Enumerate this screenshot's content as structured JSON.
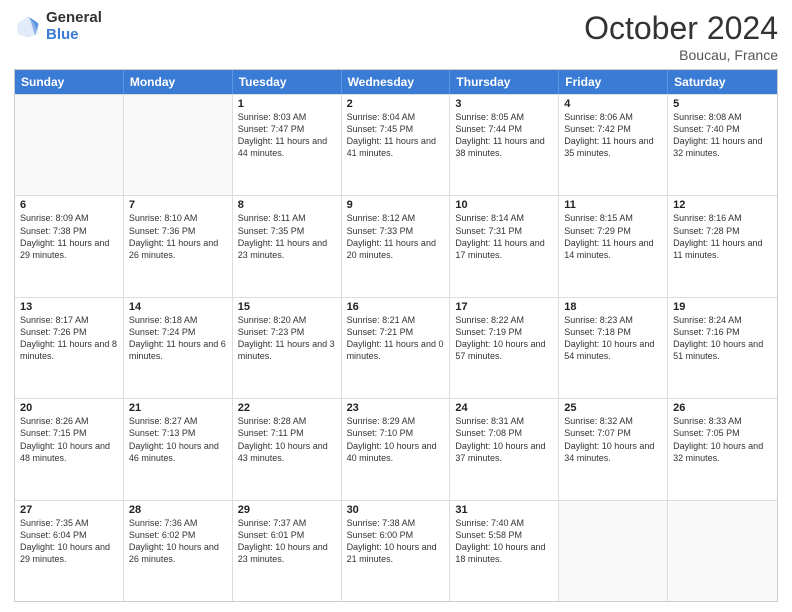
{
  "logo": {
    "general": "General",
    "blue": "Blue"
  },
  "header": {
    "month": "October 2024",
    "location": "Boucau, France"
  },
  "weekdays": [
    "Sunday",
    "Monday",
    "Tuesday",
    "Wednesday",
    "Thursday",
    "Friday",
    "Saturday"
  ],
  "rows": [
    [
      {
        "day": "",
        "info": "",
        "empty": true
      },
      {
        "day": "",
        "info": "",
        "empty": true
      },
      {
        "day": "1",
        "info": "Sunrise: 8:03 AM\nSunset: 7:47 PM\nDaylight: 11 hours and 44 minutes."
      },
      {
        "day": "2",
        "info": "Sunrise: 8:04 AM\nSunset: 7:45 PM\nDaylight: 11 hours and 41 minutes."
      },
      {
        "day": "3",
        "info": "Sunrise: 8:05 AM\nSunset: 7:44 PM\nDaylight: 11 hours and 38 minutes."
      },
      {
        "day": "4",
        "info": "Sunrise: 8:06 AM\nSunset: 7:42 PM\nDaylight: 11 hours and 35 minutes."
      },
      {
        "day": "5",
        "info": "Sunrise: 8:08 AM\nSunset: 7:40 PM\nDaylight: 11 hours and 32 minutes."
      }
    ],
    [
      {
        "day": "6",
        "info": "Sunrise: 8:09 AM\nSunset: 7:38 PM\nDaylight: 11 hours and 29 minutes."
      },
      {
        "day": "7",
        "info": "Sunrise: 8:10 AM\nSunset: 7:36 PM\nDaylight: 11 hours and 26 minutes."
      },
      {
        "day": "8",
        "info": "Sunrise: 8:11 AM\nSunset: 7:35 PM\nDaylight: 11 hours and 23 minutes."
      },
      {
        "day": "9",
        "info": "Sunrise: 8:12 AM\nSunset: 7:33 PM\nDaylight: 11 hours and 20 minutes."
      },
      {
        "day": "10",
        "info": "Sunrise: 8:14 AM\nSunset: 7:31 PM\nDaylight: 11 hours and 17 minutes."
      },
      {
        "day": "11",
        "info": "Sunrise: 8:15 AM\nSunset: 7:29 PM\nDaylight: 11 hours and 14 minutes."
      },
      {
        "day": "12",
        "info": "Sunrise: 8:16 AM\nSunset: 7:28 PM\nDaylight: 11 hours and 11 minutes."
      }
    ],
    [
      {
        "day": "13",
        "info": "Sunrise: 8:17 AM\nSunset: 7:26 PM\nDaylight: 11 hours and 8 minutes."
      },
      {
        "day": "14",
        "info": "Sunrise: 8:18 AM\nSunset: 7:24 PM\nDaylight: 11 hours and 6 minutes."
      },
      {
        "day": "15",
        "info": "Sunrise: 8:20 AM\nSunset: 7:23 PM\nDaylight: 11 hours and 3 minutes."
      },
      {
        "day": "16",
        "info": "Sunrise: 8:21 AM\nSunset: 7:21 PM\nDaylight: 11 hours and 0 minutes."
      },
      {
        "day": "17",
        "info": "Sunrise: 8:22 AM\nSunset: 7:19 PM\nDaylight: 10 hours and 57 minutes."
      },
      {
        "day": "18",
        "info": "Sunrise: 8:23 AM\nSunset: 7:18 PM\nDaylight: 10 hours and 54 minutes."
      },
      {
        "day": "19",
        "info": "Sunrise: 8:24 AM\nSunset: 7:16 PM\nDaylight: 10 hours and 51 minutes."
      }
    ],
    [
      {
        "day": "20",
        "info": "Sunrise: 8:26 AM\nSunset: 7:15 PM\nDaylight: 10 hours and 48 minutes."
      },
      {
        "day": "21",
        "info": "Sunrise: 8:27 AM\nSunset: 7:13 PM\nDaylight: 10 hours and 46 minutes."
      },
      {
        "day": "22",
        "info": "Sunrise: 8:28 AM\nSunset: 7:11 PM\nDaylight: 10 hours and 43 minutes."
      },
      {
        "day": "23",
        "info": "Sunrise: 8:29 AM\nSunset: 7:10 PM\nDaylight: 10 hours and 40 minutes."
      },
      {
        "day": "24",
        "info": "Sunrise: 8:31 AM\nSunset: 7:08 PM\nDaylight: 10 hours and 37 minutes."
      },
      {
        "day": "25",
        "info": "Sunrise: 8:32 AM\nSunset: 7:07 PM\nDaylight: 10 hours and 34 minutes."
      },
      {
        "day": "26",
        "info": "Sunrise: 8:33 AM\nSunset: 7:05 PM\nDaylight: 10 hours and 32 minutes."
      }
    ],
    [
      {
        "day": "27",
        "info": "Sunrise: 7:35 AM\nSunset: 6:04 PM\nDaylight: 10 hours and 29 minutes."
      },
      {
        "day": "28",
        "info": "Sunrise: 7:36 AM\nSunset: 6:02 PM\nDaylight: 10 hours and 26 minutes."
      },
      {
        "day": "29",
        "info": "Sunrise: 7:37 AM\nSunset: 6:01 PM\nDaylight: 10 hours and 23 minutes."
      },
      {
        "day": "30",
        "info": "Sunrise: 7:38 AM\nSunset: 6:00 PM\nDaylight: 10 hours and 21 minutes."
      },
      {
        "day": "31",
        "info": "Sunrise: 7:40 AM\nSunset: 5:58 PM\nDaylight: 10 hours and 18 minutes."
      },
      {
        "day": "",
        "info": "",
        "empty": true
      },
      {
        "day": "",
        "info": "",
        "empty": true
      }
    ]
  ]
}
